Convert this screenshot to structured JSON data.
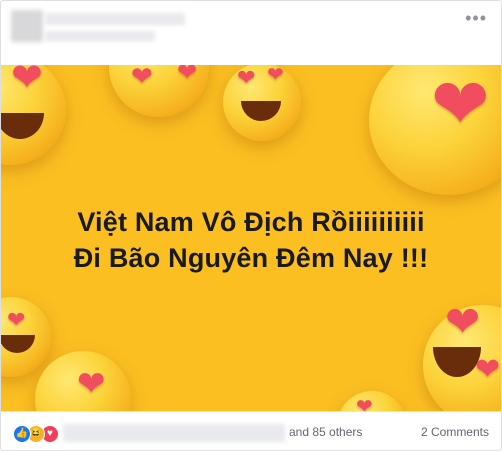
{
  "post": {
    "more_glyph": "•••",
    "message_line1": "Việt Nam Vô Địch Rồiiiiiiiiii",
    "message_line2": "Đi Bão Nguyên Đêm Nay !!!",
    "banner_color": "#fbbf22"
  },
  "footer": {
    "reaction_icons": [
      "like-icon",
      "haha-icon",
      "love-icon"
    ],
    "reactions_suffix": "and 85 others",
    "comments": "2 Comments"
  }
}
